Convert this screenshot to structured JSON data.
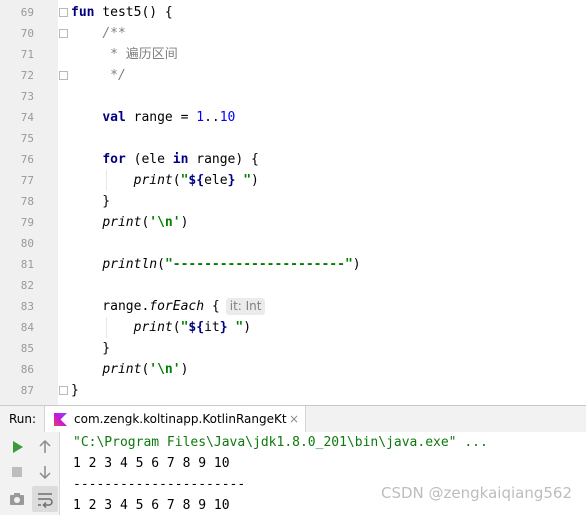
{
  "editor": {
    "lines": [
      {
        "num": "69",
        "parts": [
          [
            "kw",
            "fun"
          ],
          [
            "plain",
            " test5() {"
          ]
        ]
      },
      {
        "num": "70",
        "parts": [
          [
            "plain",
            "    "
          ],
          [
            "cmt",
            "/**"
          ]
        ]
      },
      {
        "num": "71",
        "parts": [
          [
            "plain",
            "     "
          ],
          [
            "cmt",
            "* "
          ],
          [
            "cmtcn",
            "遍历区间"
          ]
        ]
      },
      {
        "num": "72",
        "parts": [
          [
            "plain",
            "     "
          ],
          [
            "cmt",
            "*/"
          ]
        ]
      },
      {
        "num": "73",
        "parts": []
      },
      {
        "num": "74",
        "parts": [
          [
            "plain",
            "    "
          ],
          [
            "kw",
            "val"
          ],
          [
            "plain",
            " range = "
          ],
          [
            "num",
            "1"
          ],
          [
            "plain",
            ".."
          ],
          [
            "num",
            "10"
          ]
        ]
      },
      {
        "num": "75",
        "parts": []
      },
      {
        "num": "76",
        "parts": [
          [
            "plain",
            "    "
          ],
          [
            "kw",
            "for"
          ],
          [
            "plain",
            " (ele "
          ],
          [
            "kw",
            "in"
          ],
          [
            "plain",
            " range) {"
          ]
        ]
      },
      {
        "num": "77",
        "parts": [
          [
            "plain",
            "        "
          ],
          [
            "fn",
            "print"
          ],
          [
            "plain",
            "("
          ],
          [
            "str",
            "\""
          ],
          [
            "tpl",
            "${"
          ],
          [
            "plain",
            "ele"
          ],
          [
            "tpl",
            "}"
          ],
          [
            "str",
            " \""
          ],
          [
            "plain",
            ")"
          ]
        ]
      },
      {
        "num": "78",
        "parts": [
          [
            "plain",
            "    }"
          ]
        ]
      },
      {
        "num": "79",
        "parts": [
          [
            "plain",
            "    "
          ],
          [
            "fn",
            "print"
          ],
          [
            "plain",
            "("
          ],
          [
            "str",
            "'\\n'"
          ],
          [
            "plain",
            ")"
          ]
        ]
      },
      {
        "num": "80",
        "parts": []
      },
      {
        "num": "81",
        "parts": [
          [
            "plain",
            "    "
          ],
          [
            "fn",
            "println"
          ],
          [
            "plain",
            "("
          ],
          [
            "str",
            "\"----------------------\""
          ],
          [
            "plain",
            ")"
          ]
        ]
      },
      {
        "num": "82",
        "parts": []
      },
      {
        "num": "83",
        "parts": [
          [
            "plain",
            "    range."
          ],
          [
            "fn",
            "forEach"
          ],
          [
            "plain",
            " {"
          ],
          [
            "hint",
            "it: Int"
          ]
        ]
      },
      {
        "num": "84",
        "parts": [
          [
            "plain",
            "        "
          ],
          [
            "fn",
            "print"
          ],
          [
            "plain",
            "("
          ],
          [
            "str",
            "\""
          ],
          [
            "tpl",
            "${"
          ],
          [
            "plain",
            "it"
          ],
          [
            "tpl",
            "}"
          ],
          [
            "str",
            " \""
          ],
          [
            "plain",
            ")"
          ]
        ]
      },
      {
        "num": "85",
        "parts": [
          [
            "plain",
            "    }"
          ]
        ]
      },
      {
        "num": "86",
        "parts": [
          [
            "plain",
            "    "
          ],
          [
            "fn",
            "print"
          ],
          [
            "plain",
            "("
          ],
          [
            "str",
            "'\\n'"
          ],
          [
            "plain",
            ")"
          ]
        ]
      },
      {
        "num": "87",
        "parts": [
          [
            "plain",
            "}"
          ]
        ]
      }
    ]
  },
  "run_panel": {
    "label": "Run:",
    "tab_label": "com.zengk.koltinapp.KotlinRangeKt",
    "tab_close": "×",
    "tab_icon": "kotlin-icon",
    "toolbar_icons": [
      "run-icon",
      "up-arrow-icon",
      "stop-icon",
      "down-arrow-icon",
      "camera-icon",
      "soft-wrap-icon"
    ],
    "console": {
      "command": "\"C:\\Program Files\\Java\\jdk1.8.0_201\\bin\\java.exe\" ...",
      "output1": "1 2 3 4 5 6 7 8 9 10",
      "divider": "----------------------",
      "output2": "1 2 3 4 5 6 7 8 9 10"
    },
    "watermark": "CSDN @zengkaiqiang562"
  },
  "colors": {
    "keyword": "#000080",
    "number": "#0000ff",
    "string": "#008000",
    "comment": "#808080",
    "run_green": "#3b9a3b"
  }
}
